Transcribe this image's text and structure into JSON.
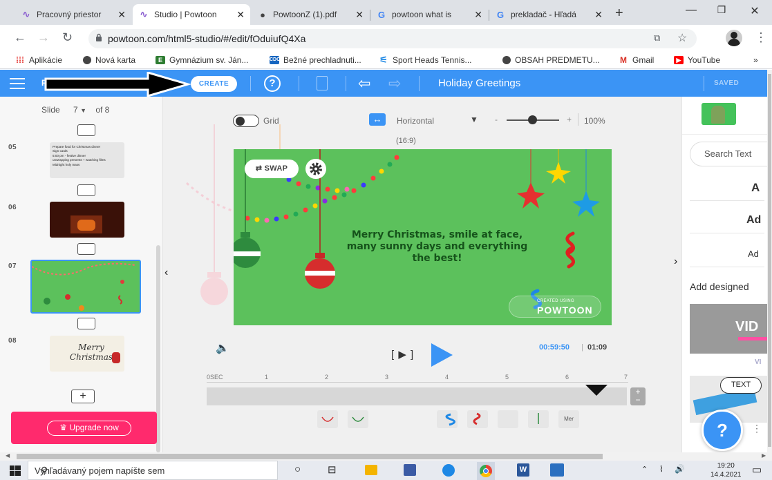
{
  "browser": {
    "tabs": [
      {
        "label": "Pracovný priestor",
        "icon": "powtoon-icon",
        "active": false
      },
      {
        "label": "Studio | Powtoon",
        "icon": "powtoon-icon",
        "active": true
      },
      {
        "label": "PowtoonZ (1).pdf",
        "icon": "globe-icon",
        "active": false
      },
      {
        "label": "powtoon what is",
        "icon": "google-icon",
        "active": false
      },
      {
        "label": "prekladač - Hľadá",
        "icon": "google-icon",
        "active": false
      }
    ],
    "new_tab": "+",
    "url": "powtoon.com/html5-studio/#/edit/fOduiufQ4Xa",
    "bookmarks": [
      {
        "label": "Aplikácie",
        "icon": "apps-grid-icon",
        "color": "#e53935"
      },
      {
        "label": "Nová karta",
        "icon": "globe-icon",
        "color": "#444444"
      },
      {
        "label": "Gymnázium sv. Ján...",
        "icon": "e-icon",
        "color": "#2e7d32"
      },
      {
        "label": "Bežné prechladnuti...",
        "icon": "cdc-icon",
        "color": "#1565c0"
      },
      {
        "label": "Sport Heads Tennis...",
        "icon": "sport-icon",
        "color": "#1e88e5"
      },
      {
        "label": "OBSAH PREDMETU...",
        "icon": "globe-icon",
        "color": "#444444"
      },
      {
        "label": "Gmail",
        "icon": "gmail-icon",
        "color": "#d93025"
      },
      {
        "label": "YouTube",
        "icon": "youtube-icon",
        "color": "#ff0000"
      }
    ],
    "bookmarks_more": "»"
  },
  "header": {
    "create_label": "CREATE",
    "title": "Holiday Greetings",
    "saved_label": "SAVED",
    "brand_color": "#3b94f5"
  },
  "left_panel": {
    "slide_label": "Slide",
    "slide_value": "7",
    "slide_of": "of 8",
    "slides": [
      {
        "number": "05",
        "bullets": [
          "Prepare food for Christmas dinner",
          "Sign cards",
          "5:00 pm - festive dinner",
          "unwrapping presents + watching films",
          "Midnight holy mass"
        ]
      },
      {
        "number": "06"
      },
      {
        "number": "07"
      },
      {
        "number": "08",
        "title": "Merry Christmas"
      }
    ],
    "add_slide": "+",
    "upgrade_label": "Upgrade now"
  },
  "stage": {
    "grid_label": "Grid",
    "orientation_label": "Horizontal",
    "ratio_label": "(16:9)",
    "zoom_minus": "-",
    "zoom_plus": "+",
    "zoom_value": "100%",
    "swap_label": "SWAP",
    "message": "Merry Christmas, smile at face, many sunny days and everything the best!",
    "logo_small": "CREATED USING",
    "logo_big": "POWTOON",
    "slide_color": "#5cc15c"
  },
  "player": {
    "play_bracket": "[ ▶ ]",
    "time_current": "00:59:50",
    "time_total": "01:09",
    "ticks": [
      "0SEC",
      "1",
      "2",
      "3",
      "4",
      "5",
      "6",
      "7"
    ],
    "timeline_item_label": "Mer"
  },
  "right_panel": {
    "search_placeholder": "Search Text",
    "items": [
      "A",
      "Ad",
      "Ad"
    ],
    "add_designed": "Add designed",
    "vid_label": "VID",
    "vi_label": "VI",
    "text_label": "TEXT",
    "help_label": "?"
  },
  "taskbar": {
    "search_placeholder": "Vyhľadávaný pojem napíšte sem",
    "time": "19:20",
    "date": "14.4.2021"
  }
}
